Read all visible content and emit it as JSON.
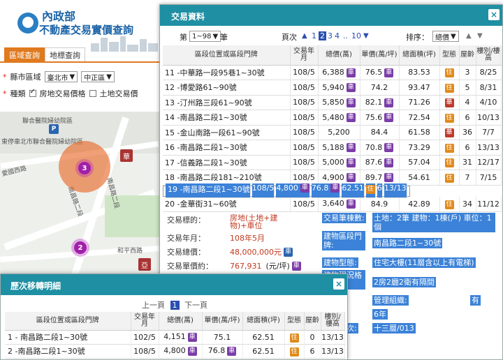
{
  "site": {
    "title_line1": "內政部",
    "title_line2": "不動產交易實價查詢",
    "tab_region": "區域查詢",
    "tab_landmark": "地標查詢",
    "label_city": "縣市區域",
    "city_value": "臺北市",
    "district_value": "中正區",
    "label_type": "種類",
    "opt_house": "房地交易價格",
    "opt_land": "土地交易價",
    "map": {
      "label_hospital": "聯合醫院婦幼院區",
      "label_parking": "東停車北市聯合醫院婦幼院區",
      "label_road1": "南昌路二段",
      "label_road2": "愛國西路",
      "label_road3": "和平西路",
      "label_road4": "南昌路二段",
      "cluster_big": "3",
      "cluster_small": "2",
      "pin_hua": "華",
      "pin_ya": "亞",
      "parking": "P"
    }
  },
  "trade": {
    "title": "交易資料",
    "close": "×",
    "range_prefix": "第",
    "range_value": "1~98",
    "range_suffix": "筆",
    "page_label": "頁次",
    "pages": [
      "1",
      "2",
      "3",
      "4",
      "..",
      "10"
    ],
    "sort_label": "排序：",
    "sort_value": "總價",
    "headers": [
      "區段位置或區段門牌",
      "交易年月",
      "總價(萬)",
      "單價(萬/坪)",
      "總面積(坪)",
      "型態",
      "屋齡",
      "樓別/樓高"
    ],
    "rows": [
      {
        "addr": "11 -中華路一段95巷1~30號",
        "ym": "108/5",
        "total": "6,388",
        "unit": "76.5",
        "area": "83.53",
        "type": "住",
        "age": "3",
        "floor": "8/25",
        "tb": "a",
        "ub": "a"
      },
      {
        "addr": "12 -博愛路61~90號",
        "ym": "108/5",
        "total": "5,940",
        "unit": "74.2",
        "area": "93.47",
        "type": "住",
        "age": "5",
        "floor": "8/31",
        "tb": "a",
        "ub": ""
      },
      {
        "addr": "13 -汀州路三段61~90號",
        "ym": "108/5",
        "total": "5,850",
        "unit": "82.1",
        "area": "71.26",
        "type": "華",
        "age": "4",
        "floor": "4/10",
        "tb": "a",
        "ub": "a"
      },
      {
        "addr": "14 -南昌路二段1~30號",
        "ym": "108/5",
        "total": "5,480",
        "unit": "75.6",
        "area": "72.54",
        "type": "住",
        "age": "6",
        "floor": "10/13",
        "tb": "a",
        "ub": "a"
      },
      {
        "addr": "15 -金山南路一段61~90號",
        "ym": "108/5",
        "total": "5,200",
        "unit": "84.4",
        "area": "61.58",
        "type": "華",
        "age": "36",
        "floor": "7/7",
        "tb": "",
        "ub": ""
      },
      {
        "addr": "16 -南昌路二段1~30號",
        "ym": "108/5",
        "total": "5,188",
        "unit": "70.8",
        "area": "73.29",
        "type": "住",
        "age": "6",
        "floor": "13/13",
        "tb": "a",
        "ub": "a"
      },
      {
        "addr": "17 -信義路二段1~30號",
        "ym": "108/5",
        "total": "5,000",
        "unit": "87.6",
        "area": "57.04",
        "type": "住",
        "age": "31",
        "floor": "12/17",
        "tb": "a",
        "ub": "a"
      },
      {
        "addr": "18 -南昌路二段181~210號",
        "ym": "108/5",
        "total": "4,900",
        "unit": "89.7",
        "area": "54.61",
        "type": "住",
        "age": "7",
        "floor": "7/15",
        "tb": "a",
        "ub": "a"
      },
      {
        "addr": "19 -南昌路二段1~30號",
        "ym": "108/5",
        "total": "4,800",
        "unit": "76.8",
        "area": "62.51",
        "type": "住",
        "age": "6",
        "floor": "13/13",
        "tb": "a",
        "ub": "a"
      },
      {
        "addr": "20 -金華街31~60號",
        "ym": "108/5",
        "total": "3,640",
        "unit": "84.9",
        "area": "42.89",
        "type": "住",
        "age": "34",
        "floor": "11/12",
        "tb": "a",
        "ub": ""
      }
    ],
    "badge_car": "車",
    "detail": {
      "l_target": "交易標的：",
      "v_target": "房地(土地+建物)+車位",
      "l_ym": "交易年月：",
      "v_ym": "108年5月",
      "l_total": "交易總價：",
      "v_total": "48,000,000元",
      "l_unit": "交易單價約：",
      "v_unit": "767,931",
      "v_unit_suffix": "(元/坪)",
      "r_count_label": "交易筆棟數:",
      "r_count_value": "土地：2筆 建物：1棟(戶) 車位：1個",
      "r_addr_label": "建物區段門牌:",
      "r_addr_value": "南昌路二段1~30號",
      "r_type_label": "建物型態:",
      "r_type_value": "住宅大樓(11層含以上有電梯)",
      "r_layout_label": "建物現況格局:",
      "r_layout_value": "2房2廳2衛有隔間",
      "r_mgmt_label": "管理組織:",
      "r_mgmt_value": "有",
      "r_age_value": "6年",
      "r_floor_label": "移轉層次:",
      "r_floor_value": "十三層/013"
    }
  },
  "history": {
    "title": "歷次移轉明細",
    "close": "×",
    "prev": "上一頁",
    "page": "1",
    "next": "下一頁",
    "headers": [
      "區段位置或區段門牌",
      "交易年月",
      "總價(萬)",
      "單價(萬/坪)",
      "總面積(坪)",
      "型態",
      "屋齡",
      "樓別/樓高"
    ],
    "rows": [
      {
        "addr": "1 - 南昌路二段1~30號",
        "ym": "102/5",
        "total": "4,151",
        "unit": "75.1",
        "area": "62.51",
        "type": "住",
        "age": "0",
        "floor": "13/13",
        "ub": ""
      },
      {
        "addr": "2 -南昌路二段1~30號",
        "ym": "108/5",
        "total": "4,800",
        "unit": "76.8",
        "area": "62.51",
        "type": "住",
        "age": "6",
        "floor": "13/13",
        "ub": "a"
      }
    ]
  },
  "colors": {
    "header_teal": "#1f8fa3",
    "selected_row": "#3b82d8",
    "tab_orange": "#e07a1f",
    "badge_purple": "#7b3da8"
  }
}
